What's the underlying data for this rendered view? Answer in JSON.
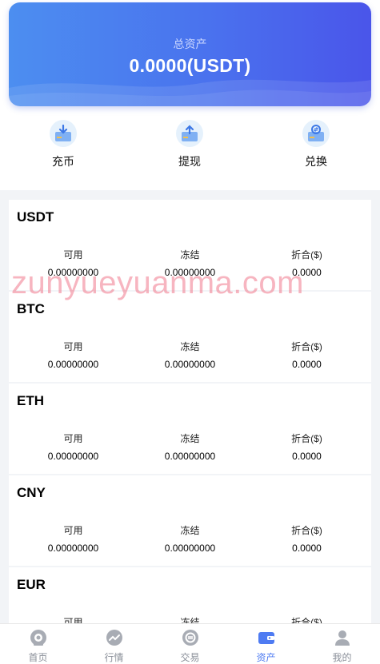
{
  "header": {
    "total_label": "总资产",
    "total_value": "0.0000(USDT)"
  },
  "actions": [
    {
      "label": "充币",
      "icon": "deposit-icon"
    },
    {
      "label": "提现",
      "icon": "withdraw-icon"
    },
    {
      "label": "兑换",
      "icon": "exchange-icon"
    }
  ],
  "columns": {
    "available": "可用",
    "frozen": "冻结",
    "converted": "折合($)"
  },
  "assets": [
    {
      "name": "USDT",
      "available": "0.00000000",
      "frozen": "0.00000000",
      "converted": "0.0000"
    },
    {
      "name": "BTC",
      "available": "0.00000000",
      "frozen": "0.00000000",
      "converted": "0.0000"
    },
    {
      "name": "ETH",
      "available": "0.00000000",
      "frozen": "0.00000000",
      "converted": "0.0000"
    },
    {
      "name": "CNY",
      "available": "0.00000000",
      "frozen": "0.00000000",
      "converted": "0.0000"
    },
    {
      "name": "EUR",
      "available": "",
      "frozen": "",
      "converted": ""
    }
  ],
  "watermark": "zunyueyuanma.com",
  "tabbar": [
    {
      "label": "首页",
      "icon": "home-icon"
    },
    {
      "label": "行情",
      "icon": "market-icon"
    },
    {
      "label": "交易",
      "icon": "trade-icon"
    },
    {
      "label": "资产",
      "icon": "wallet-icon",
      "active": true
    },
    {
      "label": "我的",
      "icon": "profile-icon"
    }
  ],
  "colors": {
    "accent": "#4e7bf2",
    "hero_start": "#4c8ef0",
    "hero_end": "#4a55ea",
    "tab_inactive": "#8a8f99"
  }
}
